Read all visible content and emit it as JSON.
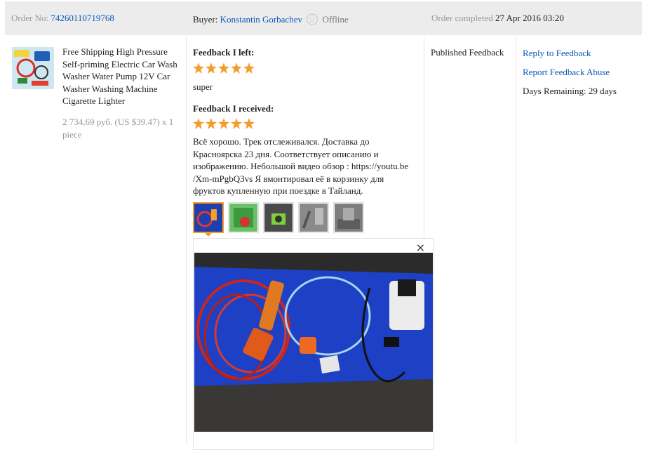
{
  "order": {
    "number_label": "Order No:",
    "number": "74260110719768",
    "buyer_label": "Buyer:",
    "buyer_name": "Konstantin Gorbachev",
    "buyer_status": "Offline",
    "completed_label": "Order completed",
    "completed_date": "27 Apr 2016 03:20"
  },
  "product": {
    "title": "Free Shipping High Pressure Self-priming Electric Car Wash Washer Water Pump 12V Car Washer Washing Machine Cigarette Lighter",
    "price": "2 734,69 руб. (US $39.47) x 1 piece"
  },
  "feedback": {
    "left_label": "Feedback I left:",
    "left_rating": 5,
    "left_text": "super",
    "received_label": "Feedback I received:",
    "received_rating": 5,
    "received_text": "Всё хорошо. Трек отслеживался. Доставка до Красноярска 23 дня. Соответствует описанию и изображению. Небольшой видео обзор : https://youtu.be /Xm-mPgbQ3vs Я вмонтировал её в корзинку для фруктов купленную при поездке в Тайланд.",
    "photo_count": 5,
    "selected_photo": 1,
    "close_symbol": "×"
  },
  "status": {
    "text": "Published Feedback"
  },
  "actions": {
    "reply": "Reply to Feedback",
    "report": "Report Feedback Abuse",
    "days_remaining": "Days Remaining: 29 days"
  },
  "icons": {
    "buyer_status": "face-offline-icon",
    "close": "close-icon",
    "star": "star-icon"
  },
  "colors": {
    "link": "#0a57b8",
    "star": "#f39c2b",
    "header_bg": "#ececec"
  }
}
